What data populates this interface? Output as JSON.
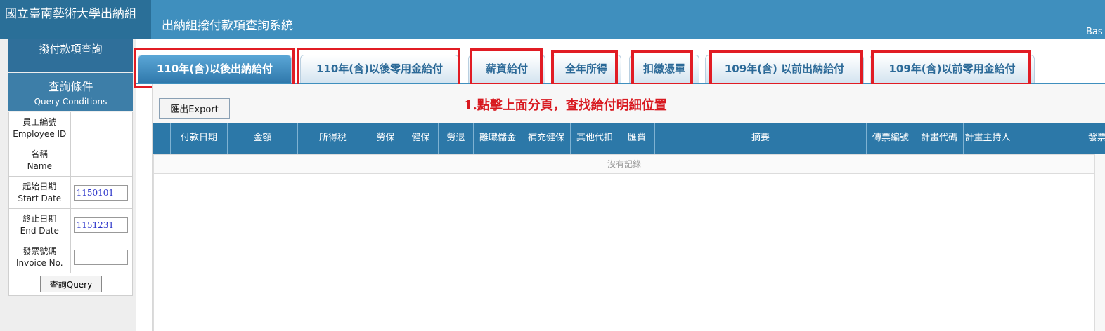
{
  "header": {
    "brand": "國立臺南藝術大學出納組",
    "system_title": "出納組撥付款項查詢系統",
    "right_text": "Bas"
  },
  "sidebar": {
    "sub_title": "撥付款項查詢",
    "conditions_zh": "查詢條件",
    "conditions_en": "Query Conditions",
    "fields": [
      {
        "label_zh": "員工編號",
        "label_en": "Employee ID",
        "value": "",
        "has_input": false
      },
      {
        "label_zh": "名稱",
        "label_en": "Name",
        "value": "",
        "has_input": false
      },
      {
        "label_zh": "起始日期",
        "label_en": "Start Date",
        "value": "1150101",
        "has_input": true
      },
      {
        "label_zh": "終止日期",
        "label_en": "End Date",
        "value": "1151231",
        "has_input": true
      },
      {
        "label_zh": "發票號碼",
        "label_en": "Invoice No.",
        "value": "",
        "has_input": true
      }
    ],
    "query_label": "查詢Query"
  },
  "tabs": [
    {
      "label": "110年(含)以後出納給付",
      "active": true
    },
    {
      "label": "110年(含)以後零用金給付",
      "active": false
    },
    {
      "label": "薪資給付",
      "active": false
    },
    {
      "label": "全年所得",
      "active": false
    },
    {
      "label": "扣繳憑單",
      "active": false
    },
    {
      "label": "109年(含) 以前出納給付",
      "active": false
    },
    {
      "label": "109年(含)以前零用金給付",
      "active": false
    }
  ],
  "toolbar": {
    "export_label": "匯出Export",
    "note": "1.點擊上面分頁，查找給付明細位置"
  },
  "grid": {
    "columns": [
      "",
      "付款日期",
      "金額",
      "所得稅",
      "勞保",
      "健保",
      "勞退",
      "離職儲金",
      "補充健保",
      "其他代扣",
      "匯費",
      "摘要",
      "傳票編號",
      "計畫代碼",
      "計畫主持人",
      "發票資訊"
    ],
    "empty_text": "沒有記錄"
  },
  "colors": {
    "header_bg": "#3f8fbe",
    "brand_bg": "#2a6f98",
    "grid_header_bg": "#2c78a8",
    "highlight": "#e11c24",
    "note_text": "#d81920"
  }
}
